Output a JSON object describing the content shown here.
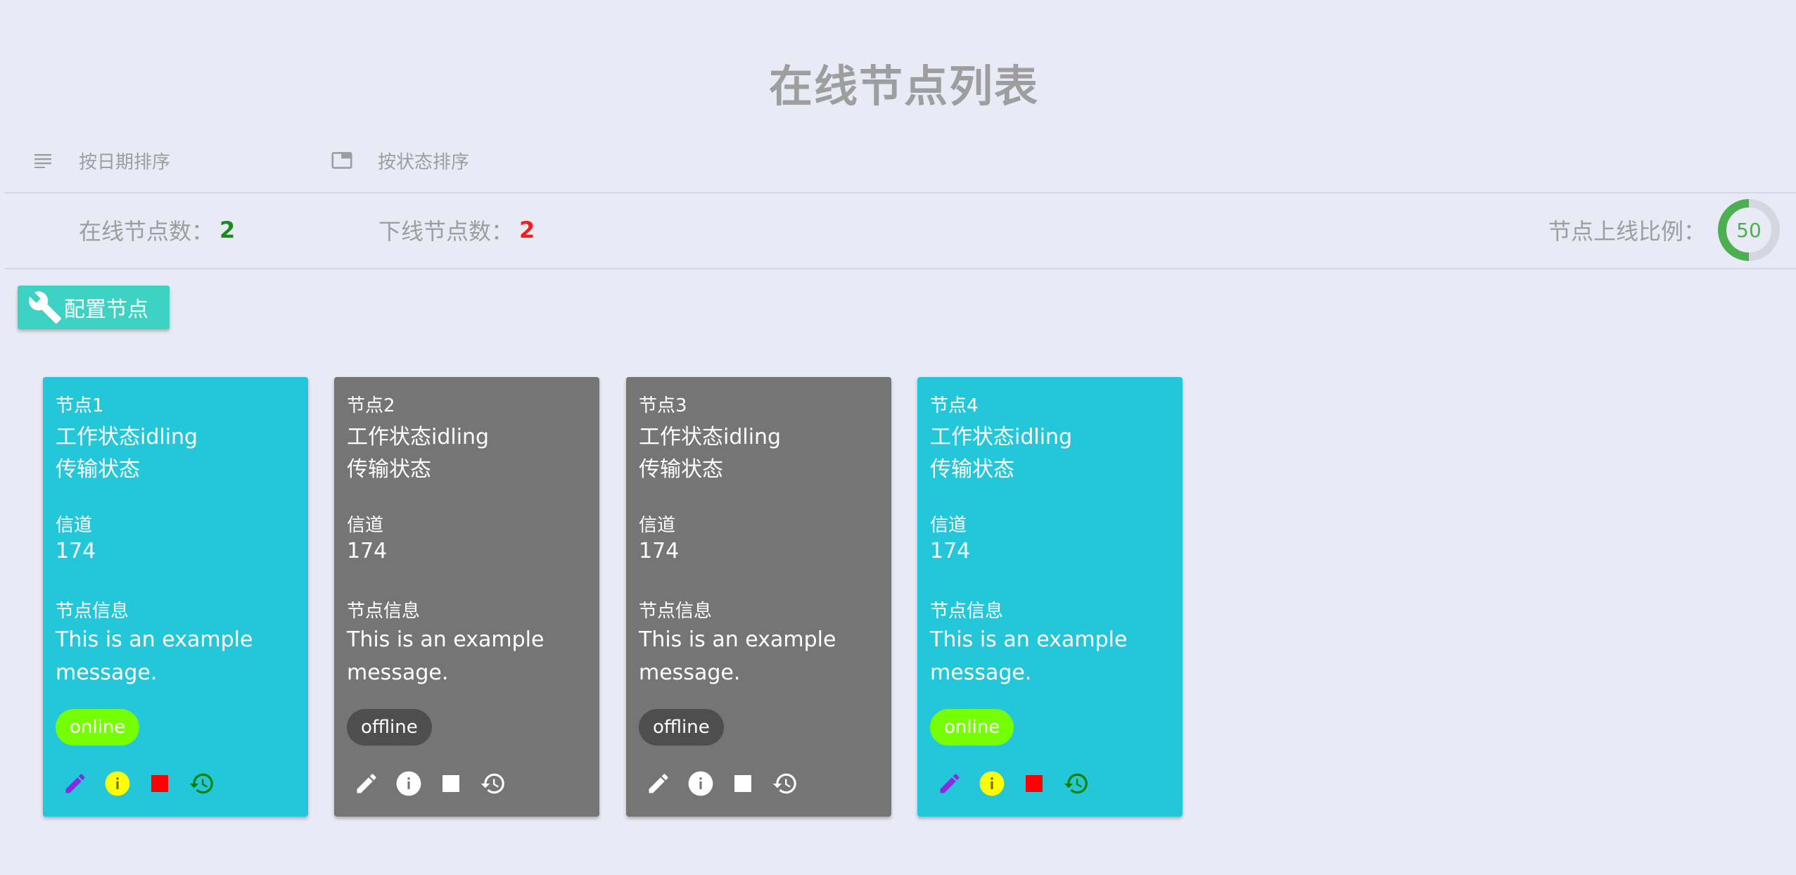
{
  "title": "在线节点列表",
  "sort": {
    "by_date": {
      "label": "按日期排序",
      "icon": "sort-lines-icon"
    },
    "by_status": {
      "label": "按状态排序",
      "icon": "folder-tab-icon"
    }
  },
  "stats": {
    "online_label": "在线节点数：",
    "online_count": "2",
    "offline_label": "下线节点数：",
    "offline_count": "2",
    "ratio_label": "节点上线比例：",
    "ratio_value": "50"
  },
  "config_button": {
    "label": "配置节点",
    "icon": "wrench-icon"
  },
  "nodes": [
    {
      "name": "节点1",
      "work_state": "工作状态idling",
      "transfer_state": "传输状态",
      "channel_label": "信道",
      "channel": "174",
      "info_label": "节点信息",
      "info": "This is an example message.",
      "status": "online"
    },
    {
      "name": "节点2",
      "work_state": "工作状态idling",
      "transfer_state": "传输状态",
      "channel_label": "信道",
      "channel": "174",
      "info_label": "节点信息",
      "info": "This is an example message.",
      "status": "offline"
    },
    {
      "name": "节点3",
      "work_state": "工作状态idling",
      "transfer_state": "传输状态",
      "channel_label": "信道",
      "channel": "174",
      "info_label": "节点信息",
      "info": "This is an example message.",
      "status": "offline"
    },
    {
      "name": "节点4",
      "work_state": "工作状态idling",
      "transfer_state": "传输状态",
      "channel_label": "信道",
      "channel": "174",
      "info_label": "节点信息",
      "info": "This is an example message.",
      "status": "online"
    }
  ],
  "colors": {
    "online_card": "#24c6da",
    "offline_card": "#757575",
    "online_chip": "#76ff03",
    "offline_chip": "#4e4e4e",
    "edit_icon": "#8a2be2",
    "info_icon": "#ffff00",
    "stop_icon": "#ff0000",
    "history_icon": "#008000"
  }
}
